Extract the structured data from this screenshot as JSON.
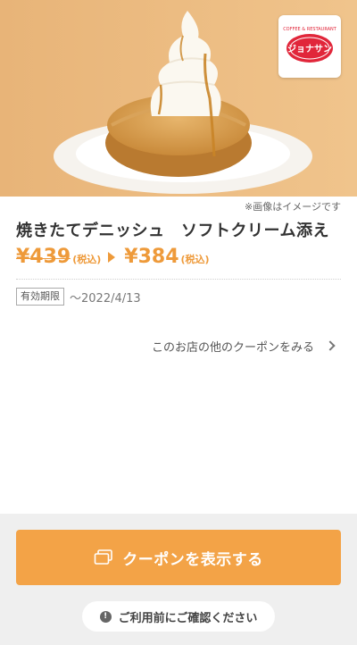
{
  "hero": {
    "image_name": "danish-pastry-soft-serve-photo"
  },
  "logo": {
    "name": "jonathan-logo",
    "text": "ジョナサン",
    "arc_text": "COFFEE & RESTAURANT"
  },
  "image_note": "※画像はイメージです",
  "product": {
    "title": "焼きたてデニッシュ　ソフトクリーム添え",
    "original_price": "¥439",
    "tax_label_old": "(税込)",
    "discount_price": "¥384",
    "tax_label_new": "(税込)"
  },
  "validity": {
    "label": "有効期限",
    "date": "〜2022/4/13"
  },
  "other_coupons": {
    "label": "このお店の他のクーポンをみる"
  },
  "footer": {
    "coupon_button_label": "クーポンを表示する",
    "confirm_label": "ご利用前にご確認ください"
  },
  "colors": {
    "accent": "#f3a347",
    "price": "#ee9a3a",
    "brand_red": "#e1263a"
  }
}
